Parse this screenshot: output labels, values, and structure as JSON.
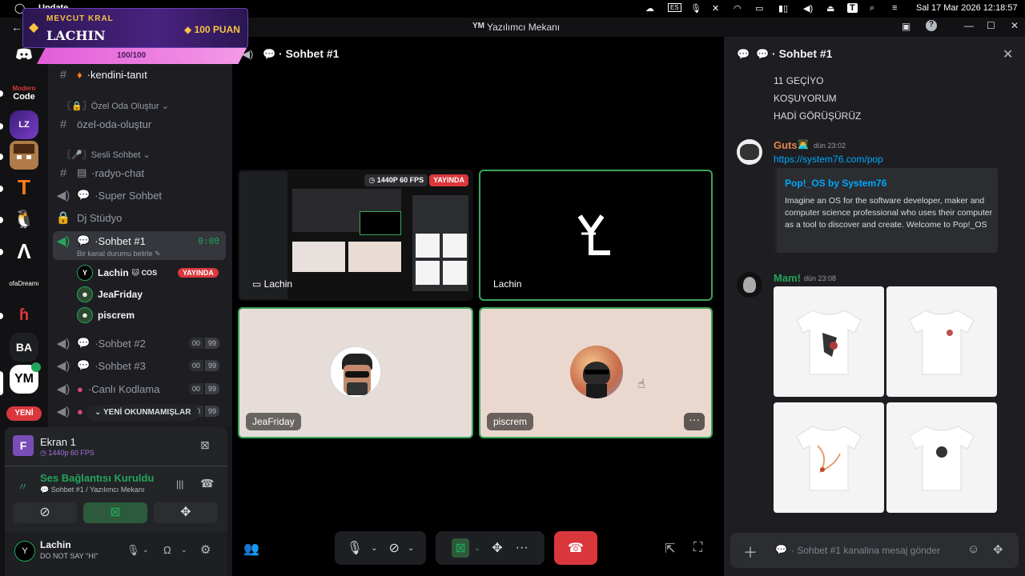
{
  "os_topbar": {
    "app_name": "Update",
    "icons": [
      "cloud-icon",
      "keyboard-layout-icon",
      "microphone-icon",
      "bluetooth-off-icon",
      "wifi-icon",
      "display-icon",
      "battery-icon",
      "volume-icon",
      "eject-icon",
      "text-icon",
      "search-icon",
      "notification-icon"
    ],
    "clock": "Sal 17 Mar 2026 12:18:57"
  },
  "window": {
    "title": "Yazılımcı Mekanı"
  },
  "overlay": {
    "rank_label": "MEVCUT KRAL",
    "name": "LACHIN",
    "points": "100 PUAN",
    "progress_text": "100/100",
    "progress": 1.0
  },
  "servers": [
    {
      "name": "discord-home",
      "label": ""
    },
    {
      "name": "code",
      "label": "Code"
    },
    {
      "name": "server-purple",
      "label": ""
    },
    {
      "name": "server-minecraft",
      "label": ""
    },
    {
      "name": "server-t",
      "label": ""
    },
    {
      "name": "server-penguin",
      "label": ""
    },
    {
      "name": "server-a",
      "label": ""
    },
    {
      "name": "server-ofadreams",
      "label": "ofaDreamı"
    },
    {
      "name": "server-red",
      "label": ""
    },
    {
      "name": "server-ba",
      "label": "BA"
    },
    {
      "name": "server-ym",
      "label": "YM"
    }
  ],
  "new_badge": "YENİ",
  "channels": {
    "kendini": "kendini-tanıt",
    "cat_ozel": "〖🔒〗Özel Oda Oluştur",
    "ozel_oda": "özel-oda-oluştur",
    "cat_sesli": "〖🎤〗Sesli Sohbet",
    "radyo": "radyo-chat",
    "super": "Super Sohbet",
    "dj": "Dj Stüdyo",
    "sohbet1": "Sohbet #1",
    "sohbet1_time": "0:00",
    "sohbet1_status": "Bir kanal durumu belirle",
    "members": [
      {
        "name": "Lachin",
        "suffix": "COS",
        "live": "YAYINDA"
      },
      {
        "name": "JeaFriday"
      },
      {
        "name": "piscrem"
      }
    ],
    "sohbet2": "Sohbet #2",
    "sohbet3": "Sohbet #3",
    "canli": "Canlı Kodlama",
    "count_a": "00",
    "count_b": "99",
    "unread_pill": "YENİ OKUNMAMIŞLAR"
  },
  "stream_panel": {
    "title": "Ekran 1",
    "quality": "1440p 60 FPS",
    "voice_status": "Ses Bağlantısı Kuruldu",
    "voice_channel": "Sohbet #1 / Yazılımcı Mekanı"
  },
  "user_panel": {
    "name": "Lachin",
    "status": "DO NOT SAY \"HI\""
  },
  "main": {
    "header": "Sohbet #1",
    "tiles": [
      {
        "name": "Lachin",
        "badge_quality": "1440P 60 FPS",
        "badge_live": "YAYINDA"
      },
      {
        "name": "Lachin"
      },
      {
        "name": "JeaFriday"
      },
      {
        "name": "piscrem"
      }
    ]
  },
  "chat": {
    "header": "Sohbet #1",
    "lines": [
      "11 GEÇİYO",
      "KOŞUYORUM",
      "HADİ GÖRÜŞÜRÜZ"
    ],
    "msg1": {
      "author": "Guts",
      "time": "dün 23:02",
      "link": "https://system76.com/pop",
      "embed_title": "Pop!_OS by System76",
      "embed_desc": "Imagine an OS for the software developer, maker and computer science professional who uses their computer as a tool to discover and create. Welcome to Pop!_OS"
    },
    "msg2": {
      "author": "Mam!",
      "time": "dün 23:08"
    },
    "input_placeholder": "Sohbet #1 kanalina mesaj gönder"
  },
  "colors": {
    "green": "#23a55a",
    "red": "#da373c",
    "blurple": "#5865f2",
    "link": "#00a8fc"
  }
}
